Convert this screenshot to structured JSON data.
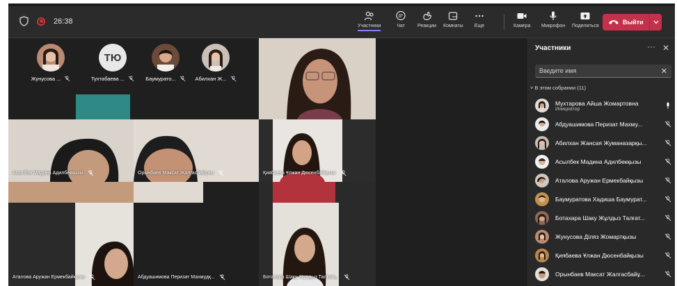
{
  "toolbar": {
    "timer": "26:38",
    "buttons": {
      "participants": "Участники",
      "chat": "Чат",
      "reactions": "Реакции",
      "rooms": "Комнаты",
      "more": "Еще",
      "camera": "Камера",
      "mic": "Микрофон",
      "share": "Поделиться"
    },
    "leave_label": "Выйти",
    "accent_color": "#c4314b"
  },
  "strip": [
    {
      "name": "Жунусова ...",
      "avatar": "photo"
    },
    {
      "name": "Тухтабаева ...",
      "avatar": "initials",
      "initials": "ТЮ"
    },
    {
      "name": "Баумурато...",
      "avatar": "photo"
    },
    {
      "name": "Абилхан Ж...",
      "avatar": "photo"
    }
  ],
  "tiles": [
    {
      "name": "Асылбек Мадина Адилбекқызы"
    },
    {
      "name": "Орынбаев Максат Жалгасбайұлы"
    },
    {
      "name": "Қиябаева Ұлжан Дюсенбайқызы"
    },
    {
      "name": "Аталова Аружан Ермекбайқызы"
    },
    {
      "name": "Абдуашимова Перизат Махмудқ..."
    },
    {
      "name": "Ботахара Шаку Жұлдыз Талғатқ..."
    }
  ],
  "panel": {
    "title": "Участники",
    "search_placeholder": "Введите имя",
    "section": "В этом собрании (11)",
    "participants": [
      {
        "name": "Мухтарова Айша Жомартовна",
        "role": "Инициатор",
        "mic": "on"
      },
      {
        "name": "Абдуашимова Перизат Махму...",
        "mic": "off"
      },
      {
        "name": "Абилхан Жансая Жуманазарқы...",
        "mic": "off"
      },
      {
        "name": "Асылбек Мадина Адилбекқызы",
        "mic": "off"
      },
      {
        "name": "Аталова Аружан Ермекбайқызы",
        "mic": "off"
      },
      {
        "name": "Баумуратова Хадиша Баумурат...",
        "mic": "off"
      },
      {
        "name": "Ботахара Шаку Жұлдыз Талғат...",
        "mic": "off"
      },
      {
        "name": "Жунусова Діляз Жомартқызы",
        "mic": "off"
      },
      {
        "name": "Қиябаева Ұлжан Дюсенбайқызы",
        "mic": "off"
      },
      {
        "name": "Орынбаев Максат Жалгасбайұ...",
        "mic": "off"
      }
    ]
  }
}
